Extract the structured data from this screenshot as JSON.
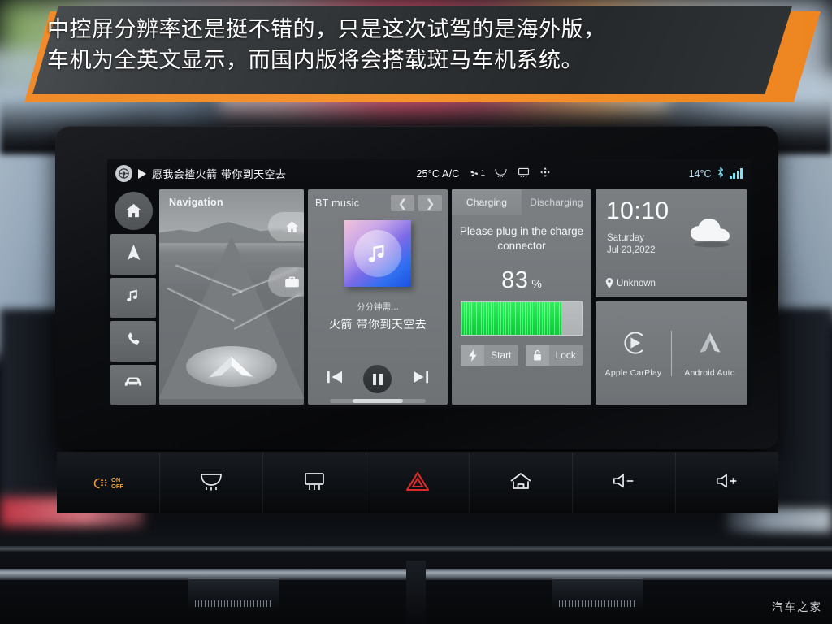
{
  "caption": {
    "text": "中控屏分辨率还是挺不错的，只是这次试驾的是海外版，\n车机为全英文显示，而国内版将会搭载斑马车机系统。",
    "accent_color": "#f08a2a",
    "panel_color": "#2e3234"
  },
  "watermark": "汽车之家",
  "head_unit": {
    "status_bar": {
      "source_icon": "steering-wheel-icon",
      "play_icon": "play-icon",
      "now_playing": "愿我会揸火箭 带你到天空去",
      "cabin_temp": "25°C A/C",
      "fan_icon": "fan-icon",
      "fan_speed": "1",
      "defrost_front_icon": "defrost-front-icon",
      "defrost_rear_icon": "defrost-rear-icon",
      "recirculate_icon": "air-recirculate-icon",
      "outside_temp": "14°C",
      "bluetooth_icon": "bluetooth-icon",
      "signal_icon": "signal-bars-icon"
    },
    "sidebar": [
      {
        "name": "home",
        "icon": "home-icon",
        "active": true
      },
      {
        "name": "navigation",
        "icon": "navigation-arrow-icon",
        "active": false
      },
      {
        "name": "music",
        "icon": "music-note-icon",
        "active": false
      },
      {
        "name": "phone",
        "icon": "phone-icon",
        "active": false
      },
      {
        "name": "vehicle",
        "icon": "car-icon",
        "active": false
      }
    ],
    "navigation_card": {
      "title": "Navigation",
      "shortcut_home_icon": "home-icon",
      "shortcut_work_icon": "briefcase-icon",
      "position_marker_icon": "nav-chevron-icon"
    },
    "music_card": {
      "title": "BT music",
      "prev_icon": "chevron-left-icon",
      "next_icon": "chevron-right-icon",
      "album_art_icon": "music-note-icon",
      "subtitle": "分分钟需...",
      "track": "火箭 带你到天空去",
      "prev_track_icon": "skip-previous-icon",
      "play_pause_icon": "pause-icon",
      "next_track_icon": "skip-next-icon"
    },
    "charge_card": {
      "tabs": [
        {
          "label": "Charging",
          "active": true
        },
        {
          "label": "Discharging",
          "active": false
        }
      ],
      "message": "Please plug in the charge connector",
      "percent_value": "83",
      "percent_unit": "%",
      "battery_level": 83,
      "battery_color": "#14ef47",
      "buttons": [
        {
          "label": "Start",
          "icon": "bolt-icon"
        },
        {
          "label": "Lock",
          "icon": "lock-open-icon"
        }
      ]
    },
    "clock_card": {
      "time": "10:10",
      "weekday": "Saturday",
      "date": "Jul 23,2022",
      "location": "Unknown",
      "location_icon": "location-pin-icon",
      "weather_icon": "cloud-icon"
    },
    "projection_card": {
      "items": [
        {
          "label": "Apple CarPlay",
          "icon": "carplay-icon"
        },
        {
          "label": "Android Auto",
          "icon": "android-auto-icon"
        }
      ]
    }
  },
  "hard_buttons": [
    {
      "name": "fog-lights",
      "icon": "fog-light-on-off-icon",
      "color": "#f0a03c"
    },
    {
      "name": "front-defrost",
      "icon": "defrost-front-icon",
      "color": "#e8ecef"
    },
    {
      "name": "rear-defrost",
      "icon": "defrost-rear-icon",
      "color": "#e8ecef"
    },
    {
      "name": "hazard-lights",
      "icon": "hazard-triangle-icon",
      "color": "#e02a2a"
    },
    {
      "name": "home",
      "icon": "home-icon",
      "color": "#e8ecef"
    },
    {
      "name": "volume-down",
      "icon": "volume-down-icon",
      "color": "#e8ecef"
    },
    {
      "name": "volume-up",
      "icon": "volume-up-icon",
      "color": "#e8ecef"
    }
  ]
}
